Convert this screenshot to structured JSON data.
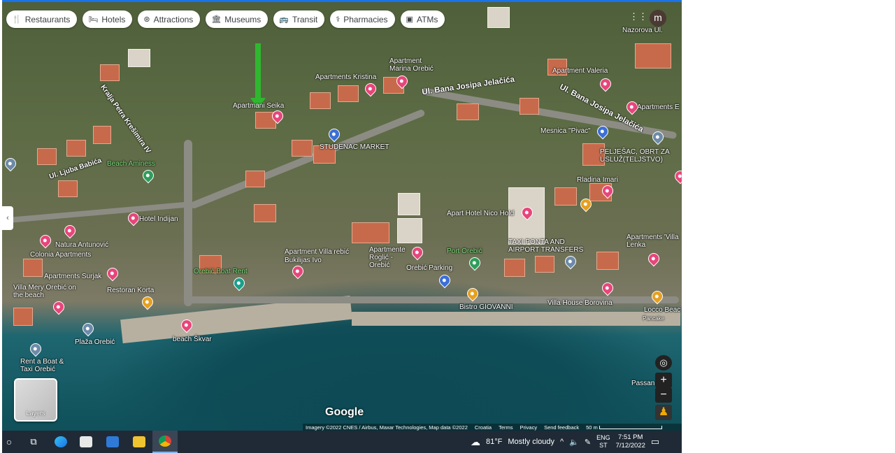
{
  "chips": [
    {
      "label": "Restaurants",
      "icon": "fork-knife-icon",
      "glyph": "🍴"
    },
    {
      "label": "Hotels",
      "icon": "bed-icon",
      "glyph": "🛏"
    },
    {
      "label": "Attractions",
      "icon": "camera-icon",
      "glyph": "⊛"
    },
    {
      "label": "Museums",
      "icon": "museum-icon",
      "glyph": "🏛"
    },
    {
      "label": "Transit",
      "icon": "bus-icon",
      "glyph": "🚌"
    },
    {
      "label": "Pharmacies",
      "icon": "pharmacy-icon",
      "glyph": "⚕"
    },
    {
      "label": "ATMs",
      "icon": "atm-icon",
      "glyph": "▣"
    }
  ],
  "account": {
    "initial": "m"
  },
  "places": {
    "apartments_seika": "Apartmani Seika",
    "apartments_kristina": "Apartments Kristina",
    "apartment_marina": "Apartment Marina Orebić",
    "apartment_valeria": "Apartment Valeria",
    "apartments_e": "Apartments E",
    "studenac": "STUDENAC MARKET",
    "mesnica": "Mesnica \"Pivac\"",
    "peljesac": "PELJEŠAC, OBRT ZA USLUŽ(TELJSTVO)",
    "beach_aminess": "Beach Aminess",
    "rladina": "Rladina Imari",
    "hotel_indijan": "Hotel Indijan",
    "apart_hotel_nico": "Apart Hotel Nico Hold",
    "natura": "Natura Antunović",
    "colonia": "Colonia Apartments",
    "apartment_villa": "Apartment Villa rebić",
    "bukilijas": "Bukilijas Ivo",
    "apartmente_roglic": "Apartmente Roglić - Orebić",
    "port_orebic": "Port Orebić",
    "taxi": "TAXI PONTA AND AIRPORT TRANSFERS",
    "apartments_villa_lenka": "Apartments 'Villa Lenka",
    "orebic_boat": "Orebić Boat Rent",
    "apartments_surjak": "Apartments Surjak",
    "restoran_korta": "Restoran Korta",
    "villa_mery": "Villa Mery Orebić on the beach",
    "orebic_parking": "Orebić Parking",
    "bistro": "Bistro GIOVANNI",
    "villa_house": "Villa House Borovina",
    "locco": "Locco Beac",
    "pancake": "Pancake",
    "plaza": "Plaža Orebić",
    "beach_skvar": "beach Škvar",
    "rent_boat": "Rent a Boat & Taxi Orebić",
    "passan": "Passan Boa",
    "nazorova": "Nazorova Ul."
  },
  "streets": {
    "jelacica_1": "Ul. Bana Josipa Jelačića",
    "jelacica_2": "Ul. Bana Josipa Jelačića",
    "kresimira": "Kralja Petra Krešimira IV",
    "babica": "Ul. Ljuba Babića"
  },
  "map_controls": {
    "layers_label": "Layers",
    "zoom_in": "+",
    "zoom_out": "−"
  },
  "branding": {
    "google": "Google"
  },
  "attribution": {
    "imagery": "Imagery ©2022 CNES / Airbus, Maxar Technologies, Map data ©2022",
    "country": "Croatia",
    "terms": "Terms",
    "privacy": "Privacy",
    "feedback": "Send feedback",
    "scale": "50 m"
  },
  "taskbar": {
    "weather_temp": "81°F",
    "weather_desc": "Mostly cloudy",
    "lang_top": "ENG",
    "lang_bottom": "ST",
    "time": "7:51 PM",
    "date": "7/12/2022"
  },
  "colors": {
    "accent": "#1a73e8",
    "pin_pink": "#e8457a",
    "taskbar": "#1f2a36",
    "arrow": "#2fb82f"
  }
}
